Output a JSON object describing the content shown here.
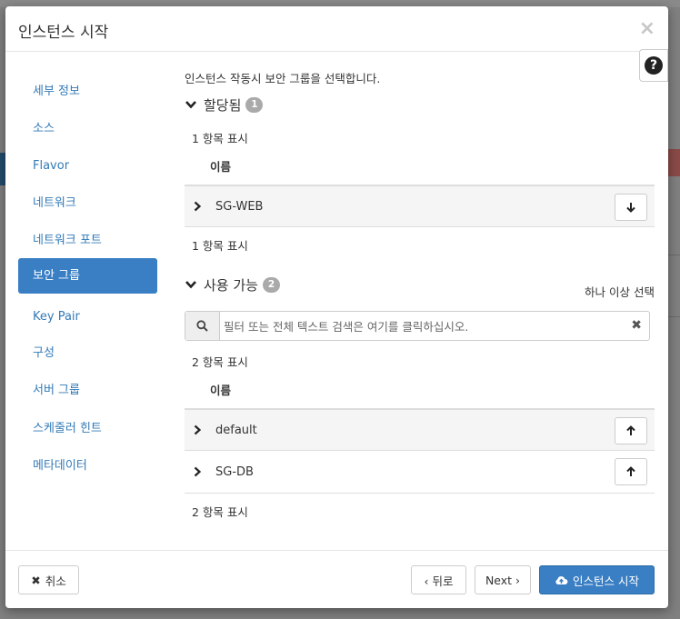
{
  "dialog": {
    "title": "인스턴스 시작",
    "close_icon": "×"
  },
  "help": {
    "icon": "?"
  },
  "nav": {
    "items": [
      {
        "label": "세부 정보",
        "active": false
      },
      {
        "label": "소스",
        "active": false
      },
      {
        "label": "Flavor",
        "active": false
      },
      {
        "label": "네트워크",
        "active": false
      },
      {
        "label": "네트워크 포트",
        "active": false
      },
      {
        "label": "보안 그룹",
        "active": true
      },
      {
        "label": "Key Pair",
        "active": false
      },
      {
        "label": "구성",
        "active": false
      },
      {
        "label": "서버 그룹",
        "active": false
      },
      {
        "label": "스케줄러 힌트",
        "active": false
      },
      {
        "label": "메타데이터",
        "active": false
      }
    ]
  },
  "main": {
    "intro": "인스턴스 작동시 보안 그룹을 선택합니다.",
    "allocated": {
      "title": "할당됨",
      "count": "1",
      "items_shown_top": "1 항목 표시",
      "column_name": "이름",
      "rows": [
        {
          "name": "SG-WEB"
        }
      ],
      "items_shown_bottom": "1 항목 표시"
    },
    "available": {
      "title": "사용 가능",
      "count": "2",
      "select_hint": "하나 이상 선택",
      "filter_placeholder": "필터 또는 전체 텍스트 검색은 여기를 클릭하십시오.",
      "items_shown_top": "2 항목 표시",
      "column_name": "이름",
      "rows": [
        {
          "name": "default"
        },
        {
          "name": "SG-DB"
        }
      ],
      "items_shown_bottom": "2 항목 표시"
    }
  },
  "footer": {
    "cancel": "취소",
    "back": "‹ 뒤로",
    "next": "Next ›",
    "launch": "인스턴스 시작"
  },
  "colors": {
    "accent": "#3a7fc4",
    "link": "#337ab7",
    "badge": "#aaaaaa"
  }
}
